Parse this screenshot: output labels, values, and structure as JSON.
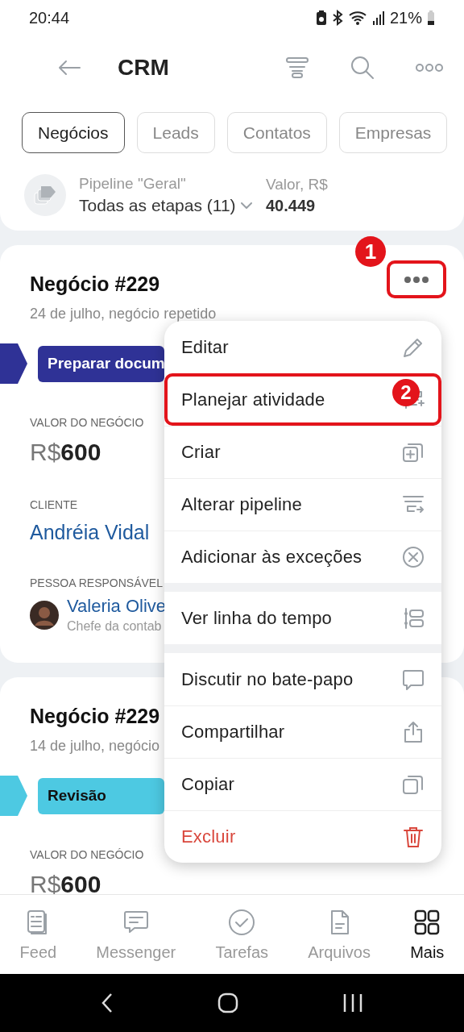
{
  "status_bar": {
    "time": "20:44",
    "battery": "21%"
  },
  "header": {
    "title": "CRM"
  },
  "tabs": [
    {
      "label": "Negócios",
      "selected": true
    },
    {
      "label": "Leads",
      "selected": false
    },
    {
      "label": "Contatos",
      "selected": false
    },
    {
      "label": "Empresas",
      "selected": false
    }
  ],
  "pipeline": {
    "label": "Pipeline \"Geral\"",
    "stage_filter": "Todas as etapas (11)",
    "value_label": "Valor, R$",
    "value": "40.449"
  },
  "deals": [
    {
      "title": "Negócio #229",
      "subtitle": "24 de julho, negócio repetido",
      "stage": "Preparar docum",
      "color": "#2f3296",
      "amount_label": "VALOR DO NEGÓCIO",
      "currency": "R$",
      "amount": "600",
      "client_label": "CLIENTE",
      "client": "Andréia Vidal",
      "responsible_label": "PESSOA RESPONSÁVEL",
      "responsible": "Valeria Olive",
      "responsible_role": "Chefe da contab"
    },
    {
      "title": "Negócio #229",
      "subtitle": "14 de julho, negócio",
      "stage": "Revisão",
      "color": "#4dc9e2",
      "amount_label": "VALOR DO NEGÓCIO",
      "currency": "R$",
      "amount": "600"
    }
  ],
  "menu": {
    "groups": [
      [
        {
          "label": "Editar",
          "kind": "normal"
        },
        {
          "label": "Planejar atividade",
          "kind": "normal"
        },
        {
          "label": "Criar",
          "kind": "normal"
        },
        {
          "label": "Alterar pipeline",
          "kind": "normal"
        },
        {
          "label": "Adicionar às exceções",
          "kind": "normal"
        }
      ],
      [
        {
          "label": "Ver linha do tempo",
          "kind": "normal"
        }
      ],
      [
        {
          "label": "Discutir no bate-papo",
          "kind": "normal"
        },
        {
          "label": "Compartilhar",
          "kind": "normal"
        },
        {
          "label": "Copiar",
          "kind": "normal"
        },
        {
          "label": "Excluir",
          "kind": "destructive"
        }
      ]
    ]
  },
  "annotations": [
    {
      "label": "1"
    },
    {
      "label": "2"
    }
  ],
  "nav": [
    {
      "label": "Feed",
      "selected": false
    },
    {
      "label": "Messenger",
      "selected": false
    },
    {
      "label": "Tarefas",
      "selected": false
    },
    {
      "label": "Arquivos",
      "selected": false
    },
    {
      "label": "Mais",
      "selected": true
    }
  ]
}
